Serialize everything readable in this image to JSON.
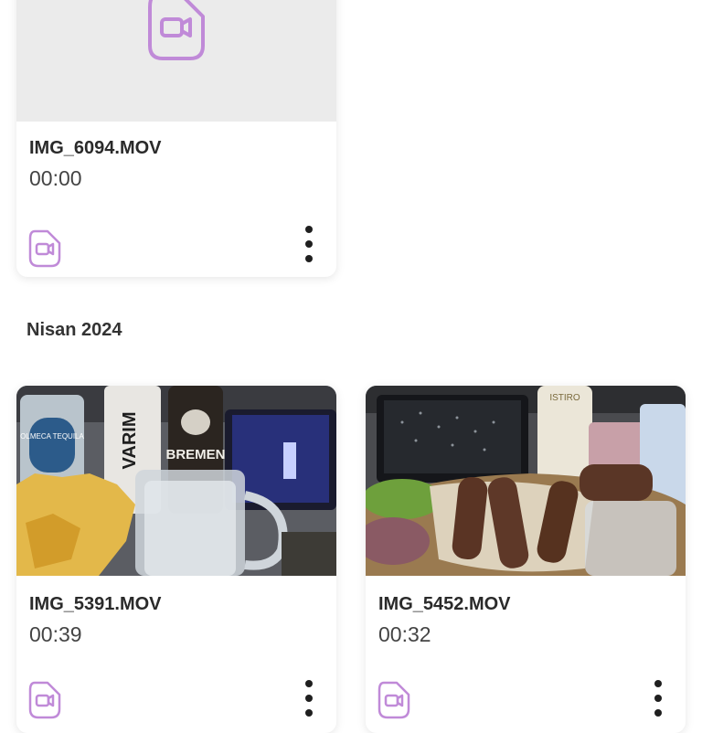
{
  "sections": [
    {
      "items": [
        {
          "name": "IMG_6094.MOV",
          "duration": "00:00"
        }
      ]
    },
    {
      "title": "Nisan 2024",
      "items": [
        {
          "name": "IMG_5391.MOV",
          "duration": "00:39"
        },
        {
          "name": "IMG_5452.MOV",
          "duration": "00:32"
        }
      ]
    }
  ],
  "icons": {
    "video_file": "video-file-icon",
    "more": "more-vertical-icon"
  },
  "colors": {
    "accent": "#c08ad8",
    "placeholder_bg": "#ebebeb"
  },
  "thumbnail_text": {
    "tequila_label": "OLMECA TEQUILA",
    "varim_label": "VARIM",
    "bremen_label": "BREMEN",
    "bottle_label": "ISTIRO"
  }
}
